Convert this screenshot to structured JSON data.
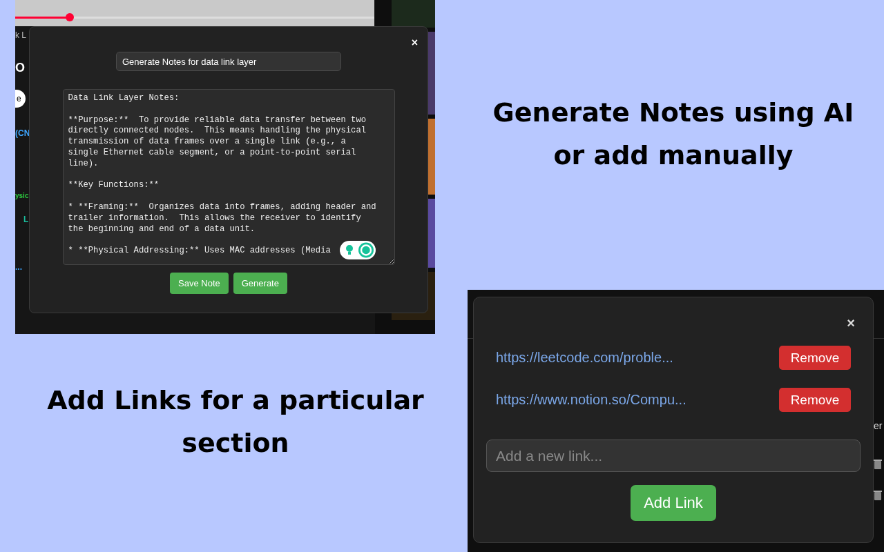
{
  "captions": [
    {
      "text": "Generate Notes using AI or add manually"
    },
    {
      "text": "Add Links for a particular section"
    }
  ],
  "notes_screenshot": {
    "background_fragments": [
      {
        "text": "k L",
        "kind": "tab"
      },
      {
        "text": "O",
        "kind": "heading"
      },
      {
        "text": "e",
        "kind": "pill"
      },
      {
        "text": "(CN",
        "kind": "link"
      },
      {
        "text": "ysic",
        "kind": "green"
      },
      {
        "text": "L",
        "kind": "teal"
      },
      {
        "text": "...",
        "kind": "link"
      }
    ],
    "dialog": {
      "close": "×",
      "title_field": {
        "value": "Generate Notes for data link layer"
      },
      "notes": {
        "value": "Data Link Layer Notes:\n\n**Purpose:**  To provide reliable data transfer between two directly connected nodes.  This means handling the physical transmission of data frames over a single link (e.g., a single Ethernet cable segment, or a point-to-point serial line).\n\n**Key Functions:**\n\n* **Framing:**  Organizes data into frames, adding header and trailer information.  This allows the receiver to identify the beginning and end of a data unit.\n\n* **Physical Addressing:** Uses MAC addresses (Media"
      },
      "buttons": [
        {
          "label": "Save Note"
        },
        {
          "label": "Generate"
        }
      ]
    }
  },
  "links_screenshot": {
    "background_fragments": [
      {
        "text": "er"
      }
    ],
    "dialog": {
      "close": "×",
      "links": [
        {
          "url": "https://leetcode.com/proble...",
          "action": "Remove"
        },
        {
          "url": "https://www.notion.so/Compu...",
          "action": "Remove"
        }
      ],
      "new_link": {
        "placeholder": "Add a new link..."
      },
      "button": {
        "label": "Add Link"
      }
    }
  }
}
